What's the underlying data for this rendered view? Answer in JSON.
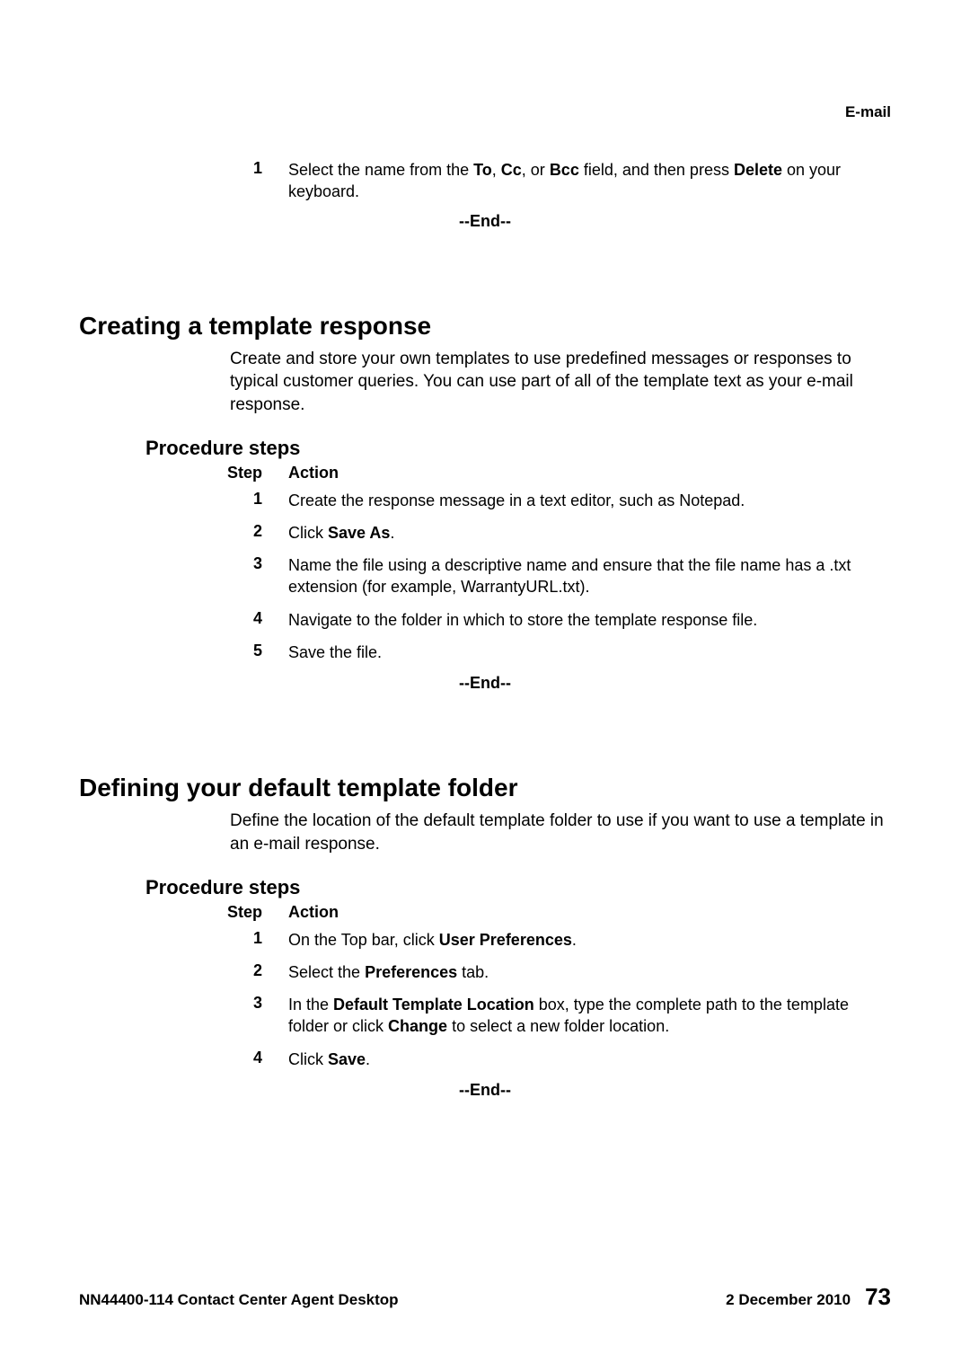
{
  "header": {
    "section": "E-mail"
  },
  "block0": {
    "step1_num": "1",
    "step1_prefix": "Select the name from the ",
    "step1_to": "To",
    "step1_comma1": ", ",
    "step1_cc": "Cc",
    "step1_comma2": ", or ",
    "step1_bcc": "Bcc",
    "step1_mid": " field, and then press ",
    "step1_delete": "Delete",
    "step1_suffix": " on your keyboard.",
    "end": "--End--"
  },
  "section1": {
    "heading": "Creating a template response",
    "intro": "Create and store your own templates to use predefined messages or responses to typical customer queries. You can use part of all of the template text as your e-mail response.",
    "procedure_heading": "Procedure steps",
    "step_label": "Step",
    "action_label": "Action",
    "s1_num": "1",
    "s1_action": "Create the response message in a text editor, such as Notepad.",
    "s2_num": "2",
    "s2_prefix": "Click ",
    "s2_bold": "Save As",
    "s2_suffix": ".",
    "s3_num": "3",
    "s3_action": "Name the file using a descriptive name and ensure that the file name has a .txt extension (for example, WarrantyURL.txt).",
    "s4_num": "4",
    "s4_action": "Navigate to the folder in which to store the template response file.",
    "s5_num": "5",
    "s5_action": "Save the file.",
    "end": "--End--"
  },
  "section2": {
    "heading": "Defining your default template folder",
    "intro": "Define the location of the default template folder to use if you want to use a template in an e-mail response.",
    "procedure_heading": "Procedure steps",
    "step_label": "Step",
    "action_label": "Action",
    "s1_num": "1",
    "s1_prefix": "On the Top bar, click ",
    "s1_bold": "User Preferences",
    "s1_suffix": ".",
    "s2_num": "2",
    "s2_prefix": "Select the ",
    "s2_bold": "Preferences",
    "s2_suffix": " tab.",
    "s3_num": "3",
    "s3_prefix": "In the ",
    "s3_bold1": "Default Template Location",
    "s3_mid": " box, type the complete path to the template folder or click ",
    "s3_bold2": "Change",
    "s3_suffix": " to select a new folder location.",
    "s4_num": "4",
    "s4_prefix": "Click ",
    "s4_bold": "Save",
    "s4_suffix": ".",
    "end": "--End--"
  },
  "footer": {
    "left": "NN44400-114 Contact Center Agent Desktop",
    "date": "2 December 2010",
    "page": "73"
  }
}
